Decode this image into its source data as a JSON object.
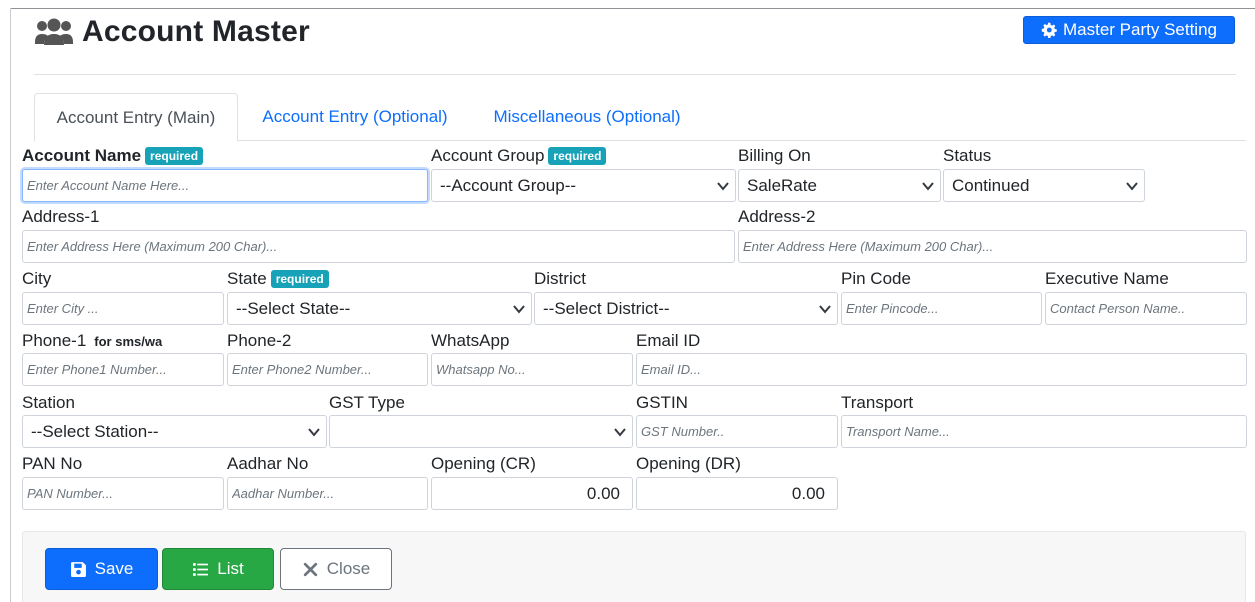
{
  "page": {
    "title": "Account Master",
    "master_party_setting": "Master Party Setting"
  },
  "tabs": [
    {
      "label": "Account Entry (Main)"
    },
    {
      "label": "Account Entry (Optional)"
    },
    {
      "label": "Miscellaneous (Optional)"
    }
  ],
  "badges": {
    "required": "required",
    "for_sms": "for sms/wa"
  },
  "fields": {
    "account_name": {
      "label": "Account Name",
      "placeholder": "Enter Account Name Here..."
    },
    "account_group": {
      "label": "Account Group",
      "value": "--Account Group--"
    },
    "billing_on": {
      "label": "Billing On",
      "value": "SaleRate"
    },
    "status": {
      "label": "Status",
      "value": "Continued"
    },
    "address1": {
      "label": "Address-1",
      "placeholder": "Enter Address Here (Maximum 200 Char)..."
    },
    "address2": {
      "label": "Address-2",
      "placeholder": "Enter Address Here (Maximum 200 Char)..."
    },
    "city": {
      "label": "City",
      "placeholder": "Enter City ..."
    },
    "state": {
      "label": "State",
      "value": "--Select State--"
    },
    "district": {
      "label": "District",
      "value": "--Select District--"
    },
    "pin_code": {
      "label": "Pin Code",
      "placeholder": "Enter Pincode..."
    },
    "executive_name": {
      "label": "Executive Name",
      "placeholder": "Contact Person Name.."
    },
    "phone1": {
      "label": "Phone-1",
      "placeholder": "Enter Phone1 Number..."
    },
    "phone2": {
      "label": "Phone-2",
      "placeholder": "Enter Phone2 Number..."
    },
    "whatsapp": {
      "label": "WhatsApp",
      "placeholder": "Whatsapp No..."
    },
    "email": {
      "label": "Email ID",
      "placeholder": "Email ID..."
    },
    "station": {
      "label": "Station",
      "value": "--Select Station--"
    },
    "gst_type": {
      "label": "GST Type",
      "value": ""
    },
    "gstin": {
      "label": "GSTIN",
      "placeholder": "GST Number.."
    },
    "transport": {
      "label": "Transport",
      "placeholder": "Transport Name..."
    },
    "pan": {
      "label": "PAN No",
      "placeholder": "PAN Number..."
    },
    "aadhar": {
      "label": "Aadhar No",
      "placeholder": "Aadhar Number..."
    },
    "opening_cr": {
      "label": "Opening (CR)",
      "value": "0.00"
    },
    "opening_dr": {
      "label": "Opening (DR)",
      "value": "0.00"
    }
  },
  "buttons": {
    "save": "Save",
    "list": "List",
    "close": "Close"
  },
  "colors": {
    "primary": "#0d6efd",
    "success": "#28a745",
    "badge": "#17a2b8",
    "secondary": "#6c757d"
  }
}
